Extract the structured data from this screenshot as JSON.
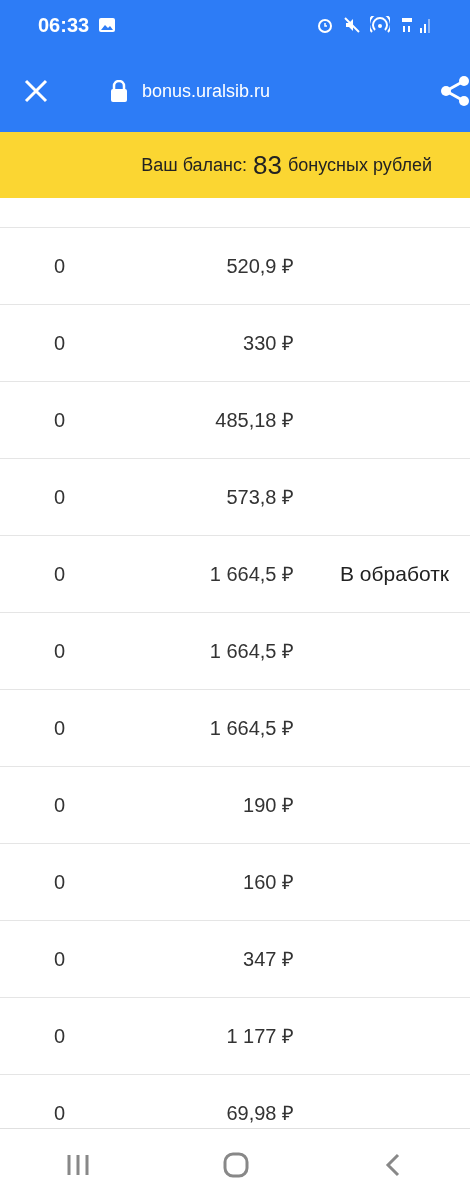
{
  "status_bar": {
    "time": "06:33"
  },
  "toolbar": {
    "url": "bonus.uralsib.ru"
  },
  "balance": {
    "label": "Ваш баланс:",
    "value": "83",
    "unit": "бонусных рублей"
  },
  "rows": [
    {
      "column_1": "0",
      "column_2": "520,9 ₽"
    },
    {
      "column_1": "0",
      "column_2": "330 ₽"
    },
    {
      "column_1": "0",
      "column_2": "485,18 ₽"
    },
    {
      "column_1": "0",
      "column_2": "573,8 ₽"
    },
    {
      "column_1": "0",
      "column_2": "1 664,5 ₽",
      "column_3": "В обработк"
    },
    {
      "column_1": "0",
      "column_2": "1 664,5 ₽"
    },
    {
      "column_1": "0",
      "column_2": "1 664,5 ₽"
    },
    {
      "column_1": "0",
      "column_2": "190 ₽"
    },
    {
      "column_1": "0",
      "column_2": "160 ₽"
    },
    {
      "column_1": "0",
      "column_2": "347 ₽"
    },
    {
      "column_1": "0",
      "column_2": "1 177 ₽"
    },
    {
      "column_1": "0",
      "column_2": "69,98 ₽"
    }
  ]
}
